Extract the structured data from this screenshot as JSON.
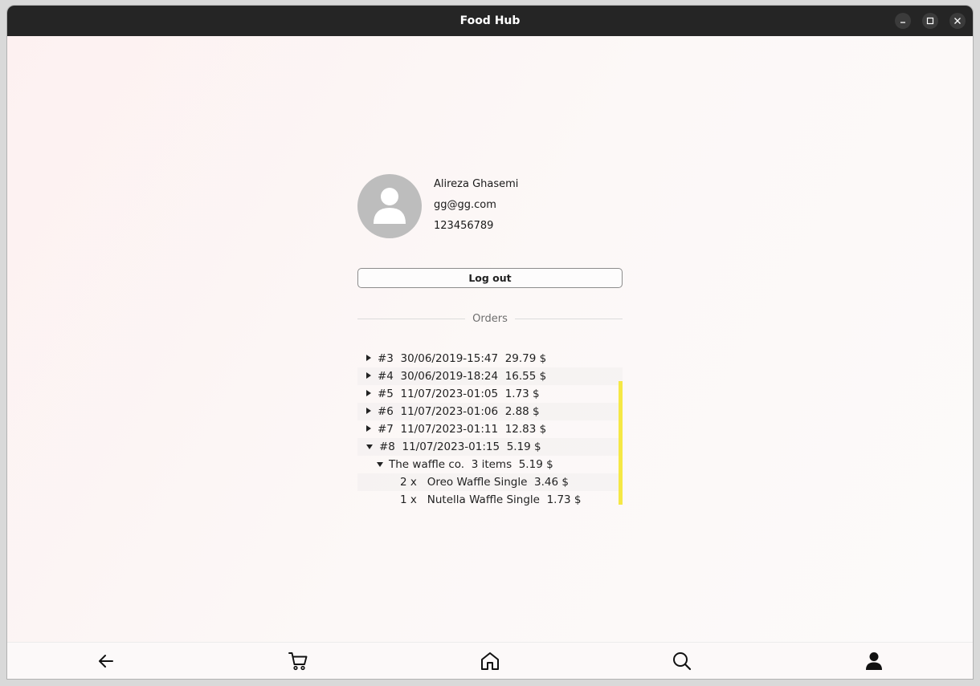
{
  "window": {
    "title": "Food Hub"
  },
  "profile": {
    "name": "Alireza Ghasemi",
    "email": "gg@gg.com",
    "phone": "123456789"
  },
  "logout_label": "Log out",
  "orders_heading": "Orders",
  "orders": [
    {
      "id": "#3",
      "date": "30/06/2019-15:47",
      "total": "29.79 $",
      "expanded": false
    },
    {
      "id": "#4",
      "date": "30/06/2019-18:24",
      "total": "16.55 $",
      "expanded": false
    },
    {
      "id": "#5",
      "date": "11/07/2023-01:05",
      "total": "1.73 $",
      "expanded": false
    },
    {
      "id": "#6",
      "date": "11/07/2023-01:06",
      "total": "2.88 $",
      "expanded": false
    },
    {
      "id": "#7",
      "date": "11/07/2023-01:11",
      "total": "12.83 $",
      "expanded": false
    },
    {
      "id": "#8",
      "date": "11/07/2023-01:15",
      "total": "5.19 $",
      "expanded": true,
      "restaurant": {
        "name": "The waffle co.",
        "items_count": "3 items",
        "total": "5.19 $"
      },
      "items": [
        {
          "qty": "2 x",
          "name": "Oreo Waffle Single",
          "price": "3.46 $"
        },
        {
          "qty": "1 x",
          "name": "Nutella Waffle Single",
          "price": "1.73 $"
        }
      ]
    }
  ],
  "nav": [
    "back-icon",
    "cart-icon",
    "home-icon",
    "search-icon",
    "user-icon"
  ],
  "colors": {
    "scrollbar": "#f5e845",
    "titlebar": "#252525"
  }
}
